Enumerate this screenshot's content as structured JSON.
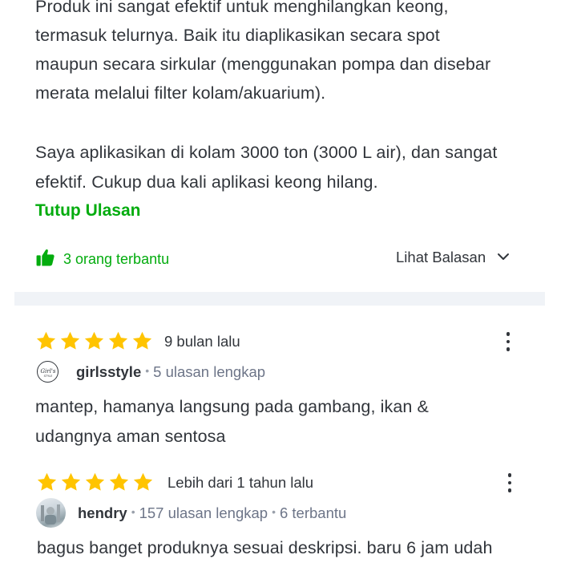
{
  "review1": {
    "lines": [
      "Produk ini sangat efektif untuk menghilangkan keong,",
      "termasuk telurnya. Baik itu diaplikasikan secara spot",
      "maupun secara sirkular (menggunakan pompa dan disebar",
      "merata melalui filter kolam/akuarium).",
      "Saya aplikasikan di kolam 3000 ton (3000 L air), dan sangat",
      "efektif. Cukup dua kali aplikasi keong hilang."
    ],
    "collapse_label": "Tutup Ulasan",
    "helpful_label": "3 orang terbantu",
    "replies_label": "Lihat Balasan",
    "icons": {
      "helpful": "thumbs-up-icon",
      "replies": "chevron-down-icon"
    }
  },
  "review2": {
    "rating": 5,
    "time": "9 bulan lalu",
    "username": "girlsstyle",
    "meta": "5 ulasan lengkap",
    "avatar_text": "Girl's Style",
    "lines": [
      "mantep, hamanya langsung pada gambang, ikan &",
      "udangnya aman sentosa"
    ],
    "icons": {
      "star": "star-icon",
      "menu": "more-vertical-icon"
    }
  },
  "review3": {
    "rating": 5,
    "time": "Lebih dari 1 tahun lalu",
    "username": "hendry",
    "meta": "157 ulasan lengkap",
    "meta2": "6 terbantu",
    "lines": [
      "bagus banget produknya sesuai deskripsi. baru 6 jam udah"
    ],
    "icons": {
      "star": "star-icon",
      "menu": "more-vertical-icon"
    }
  },
  "colors": {
    "accent_green": "#03ac0e",
    "star": "#ffc400",
    "text": "#31353b",
    "muted": "#6d7588",
    "divider": "#f0f3f7"
  }
}
